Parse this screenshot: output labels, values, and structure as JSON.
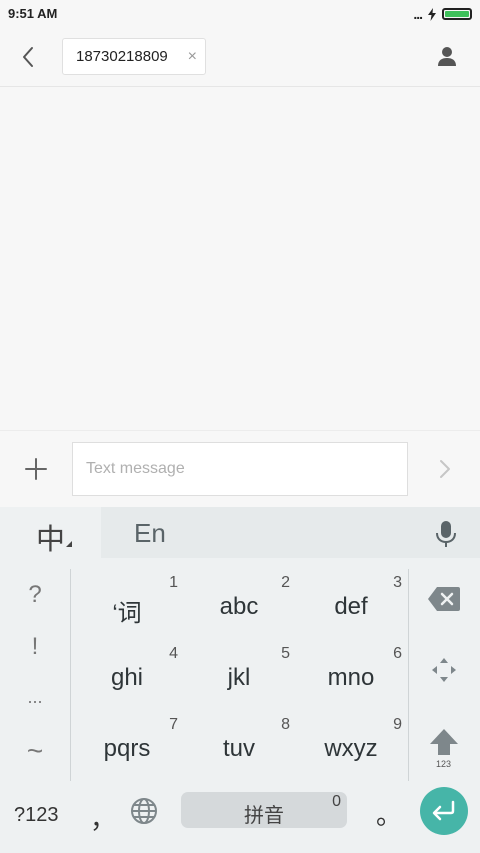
{
  "status": {
    "time": "9:51 AM",
    "dots": "...",
    "battery_level": 1.0,
    "battery_color": "#3ec05a"
  },
  "header": {
    "recipient": "18730218809",
    "remove_icon": "×"
  },
  "compose": {
    "placeholder": "Text message"
  },
  "keyboard": {
    "mode_cn": "中",
    "mode_en": "En",
    "symbols": [
      "?",
      "!",
      "...",
      "~"
    ],
    "keys": [
      {
        "label": "‘词",
        "num": "1"
      },
      {
        "label": "abc",
        "num": "2"
      },
      {
        "label": "def",
        "num": "3"
      },
      {
        "label": "ghi",
        "num": "4"
      },
      {
        "label": "jkl",
        "num": "5"
      },
      {
        "label": "mno",
        "num": "6"
      },
      {
        "label": "pqrs",
        "num": "7"
      },
      {
        "label": "tuv",
        "num": "8"
      },
      {
        "label": "wxyz",
        "num": "9"
      }
    ],
    "shift_sub": "123",
    "bottom": {
      "num_switch": "?123",
      "comma": "，",
      "space_label": "拼音",
      "space_num": "0",
      "period": "。"
    },
    "accent": "#46b5a8"
  }
}
